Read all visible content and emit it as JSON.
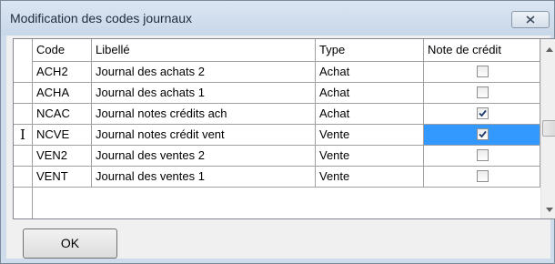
{
  "window": {
    "title": "Modification des codes journaux"
  },
  "grid": {
    "columns": [
      {
        "key": "code",
        "label": "Code"
      },
      {
        "key": "libelle",
        "label": "Libellé"
      },
      {
        "key": "type",
        "label": "Type"
      },
      {
        "key": "note_credit",
        "label": "Note de crédit"
      }
    ],
    "rows": [
      {
        "code": "ACH2",
        "libelle": "Journal des achats 2",
        "type": "Achat",
        "note_credit": false,
        "current": false
      },
      {
        "code": "ACHA",
        "libelle": "Journal des achats 1",
        "type": "Achat",
        "note_credit": false,
        "current": false
      },
      {
        "code": "NCAC",
        "libelle": "Journal notes crédits ach",
        "type": "Achat",
        "note_credit": true,
        "current": false
      },
      {
        "code": "NCVE",
        "libelle": "Journal notes crédit vent",
        "type": "Vente",
        "note_credit": true,
        "current": true
      },
      {
        "code": "VEN2",
        "libelle": "Journal des ventes 2",
        "type": "Vente",
        "note_credit": false,
        "current": false
      },
      {
        "code": "VENT",
        "libelle": "Journal des ventes 1",
        "type": "Vente",
        "note_credit": false,
        "current": false
      }
    ],
    "current_row_marker": "I",
    "selection_color": "#3399ff"
  },
  "buttons": {
    "ok_label": "OK"
  },
  "icons": {
    "close": "close-icon",
    "scroll_up": "scroll-up-arrow-icon",
    "scroll_down": "scroll-down-arrow-icon",
    "check": "checkmark-icon"
  }
}
